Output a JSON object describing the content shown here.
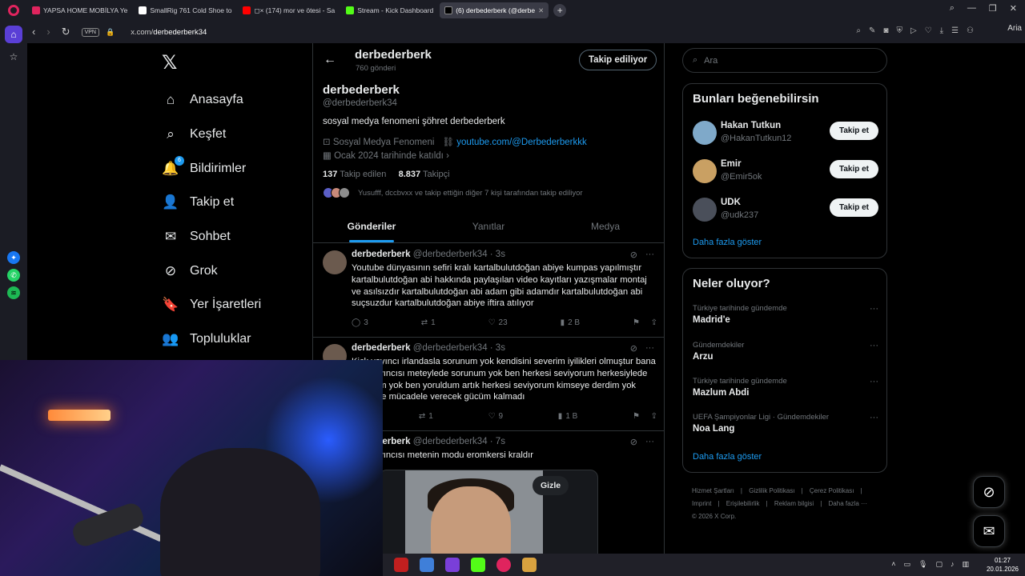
{
  "browser": {
    "tabs": [
      {
        "label": "YAPSA HOME MOBİLYA Ye",
        "color": "#e0245e"
      },
      {
        "label": "SmallRig 761 Cold Shoe to",
        "color": "#ffffff"
      },
      {
        "label": "◻× (174) mor ve ötesi - Sa",
        "color": "#ff0000"
      },
      {
        "label": "Stream - Kick Dashboard",
        "color": "#53fc18"
      },
      {
        "label": "(6) derbederberk (@derbe",
        "color": "#000000"
      }
    ],
    "new_tab": "+",
    "url_prefix": "x.com/",
    "url_path": "derbederberk34",
    "vpn": "VPN",
    "ai": "Aria"
  },
  "nav": {
    "logo": "𝕏",
    "items": [
      {
        "label": "Anasayfa",
        "icon": "⌂"
      },
      {
        "label": "Keşfet",
        "icon": "⌕"
      },
      {
        "label": "Bildirimler",
        "icon": "🔔"
      },
      {
        "label": "Takip et",
        "icon": "👤"
      },
      {
        "label": "Sohbet",
        "icon": "✉"
      },
      {
        "label": "Grok",
        "icon": "⊘"
      },
      {
        "label": "Yer İşaretleri",
        "icon": "🔖"
      },
      {
        "label": "Topluluklar",
        "icon": "👥"
      }
    ],
    "notification_count": "6"
  },
  "header": {
    "name": "derbederberk",
    "post_count": "760 gönderi",
    "follow_button": "Takip ediliyor"
  },
  "profile": {
    "name": "derbederberk",
    "handle": "@derbederberk34",
    "bio": "sosyal medya fenomeni şöhret derbederberk",
    "category": "Sosyal Medya Fenomeni",
    "link": "youtube.com/@Derbederberkkk",
    "joined": "Ocak 2024 tarihinde katıldı",
    "following_count": "137",
    "following_label": "Takip edilen",
    "followers_count": "8.837",
    "followers_label": "Takipçi",
    "mutual_text": "Yusufff, dccbvxx ve takip ettiğin diğer 7 kişi tarafından takip ediliyor"
  },
  "tabs": [
    "Gönderiler",
    "Yanıtlar",
    "Medya"
  ],
  "tweets": [
    {
      "name": "derbederberk",
      "handle": "@derbederberk34 · 3s",
      "text": "Youtube dünyasının sefiri kralı kartalbulutdoğan abiye kumpas yapılmıştır kartalbulutdoğan abi hakkında paylaşılan video kayıtları yazışmalar montaj ve asılsızdır kartalbulutdoğan abi adam gibi adamdır kartalbulutdoğan abi suçsuzdur kartalbulutdoğan abiye iftira atılıyor",
      "replies": "3",
      "reposts": "1",
      "likes": "23",
      "views": "2 B"
    },
    {
      "name": "derbederberk",
      "handle": "@derbederberk34 · 3s",
      "text": "Kick yayıncı irlandasla sorunum yok kendisini severim iyilikleri olmuştur bana kick yayıncısı meteylede sorunum yok ben herkesi seviyorum herkesiylede sorunum yok ben yoruldum artık herkesi seviyorum kimseye derdim yok kimseyle mücadele verecek gücüm kalmadı",
      "replies": "",
      "reposts": "1",
      "likes": "9",
      "views": "1 B"
    },
    {
      "name": "derbederberk",
      "handle": "@derbederberk34 · 7s",
      "text": "kick yayıncısı metenin modu eromkersi kraldır",
      "hide_button": "Gizle"
    }
  ],
  "right": {
    "search_placeholder": "Ara",
    "suggest_title": "Bunları beğenebilirsin",
    "suggestions": [
      {
        "name": "Hakan Tutkun",
        "handle": "@HakanTutkun12",
        "button": "Takip et",
        "color": "#7fa9c9"
      },
      {
        "name": "Emir",
        "handle": "@Emir5ok",
        "button": "Takip et",
        "color": "#c9a063"
      },
      {
        "name": "UDK",
        "handle": "@udk237",
        "button": "Takip et",
        "color": "#4a4f5a"
      }
    ],
    "show_more": "Daha fazla göster",
    "trends_title": "Neler oluyor?",
    "trends": [
      {
        "context": "Türkiye tarihinde gündemde",
        "title": "Madrid'e"
      },
      {
        "context": "Gündemdekiler",
        "title": "Arzu"
      },
      {
        "context": "Türkiye tarihinde gündemde",
        "title": "Mazlum Abdi"
      },
      {
        "context": "UEFA Şampiyonlar Ligi · Gündemdekiler",
        "title": "Noa Lang"
      }
    ],
    "trends_more": "Daha fazla göster",
    "footer_links": [
      "Hizmet Şartları",
      "Gizlilik Politikası",
      "Çerez Politikası",
      "Imprint",
      "Erişilebilirlik",
      "Reklam bilgisi",
      "Daha fazla ···"
    ],
    "copyright": "© 2026 X Corp."
  },
  "taskbar": {
    "time": "01:27",
    "date": "20.01.2026"
  },
  "colors": {
    "accent": "#1d9bf0",
    "background": "#000000",
    "border": "#2f3336",
    "muted": "#71767b"
  }
}
